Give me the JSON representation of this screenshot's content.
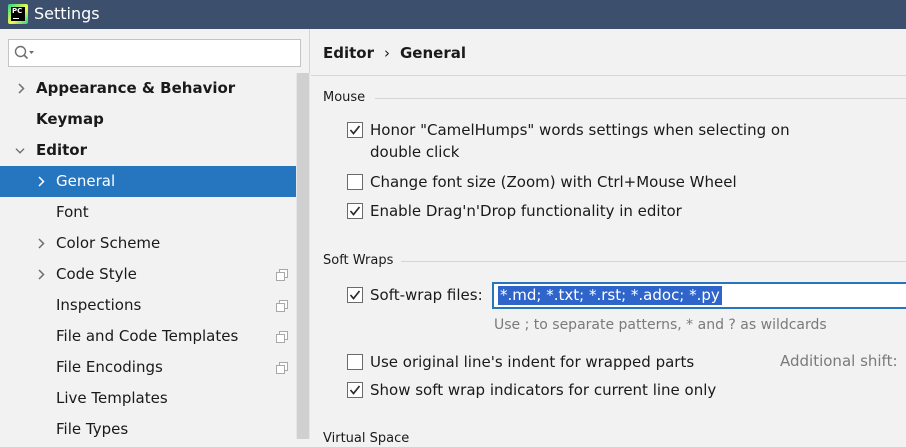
{
  "window": {
    "title": "Settings",
    "app_icon": "pycharm-icon"
  },
  "search": {
    "value": "",
    "placeholder": ""
  },
  "sidebar": {
    "items": [
      {
        "label": "Appearance & Behavior",
        "icon": "chevron-right-icon"
      },
      {
        "label": "Keymap"
      },
      {
        "label": "Editor",
        "icon": "chevron-down-icon"
      },
      {
        "label": "General",
        "icon": "chevron-right-icon",
        "selected": true
      },
      {
        "label": "Font"
      },
      {
        "label": "Color Scheme",
        "icon": "chevron-right-icon"
      },
      {
        "label": "Code Style",
        "icon": "chevron-right-icon",
        "badge_icon": "copy-icon"
      },
      {
        "label": "Inspections",
        "badge_icon": "copy-icon"
      },
      {
        "label": "File and Code Templates",
        "badge_icon": "copy-icon"
      },
      {
        "label": "File Encodings",
        "badge_icon": "copy-icon"
      },
      {
        "label": "Live Templates"
      },
      {
        "label": "File Types"
      }
    ]
  },
  "breadcrumb": {
    "parent": "Editor",
    "separator": "›",
    "current": "General"
  },
  "sections": {
    "mouse": {
      "title": "Mouse",
      "options": [
        {
          "line1": "Honor \"CamelHumps\" words settings when selecting on",
          "line2": "double click",
          "checked": true
        },
        {
          "label": "Change font size (Zoom) with Ctrl+Mouse Wheel",
          "checked": false
        },
        {
          "label": "Enable Drag'n'Drop functionality in editor",
          "checked": true
        }
      ]
    },
    "soft_wraps": {
      "title": "Soft Wraps",
      "soft_wrap_files": {
        "label": "Soft-wrap files:",
        "checked": true,
        "value": "*.md; *.txt; *.rst; *.adoc; *.py"
      },
      "hint": "Use ; to separate patterns, * and ? as wildcards",
      "options": [
        {
          "label": "Use original line's indent for wrapped parts",
          "checked": false
        },
        {
          "label": "Show soft wrap indicators for current line only",
          "checked": true
        }
      ],
      "additional_shift_label": "Additional shift:"
    },
    "virtual_space": {
      "title": "Virtual Space"
    }
  },
  "colors": {
    "accent": "#2675bf",
    "title_bar": "#3c506e",
    "selection": "#2f65ca"
  }
}
